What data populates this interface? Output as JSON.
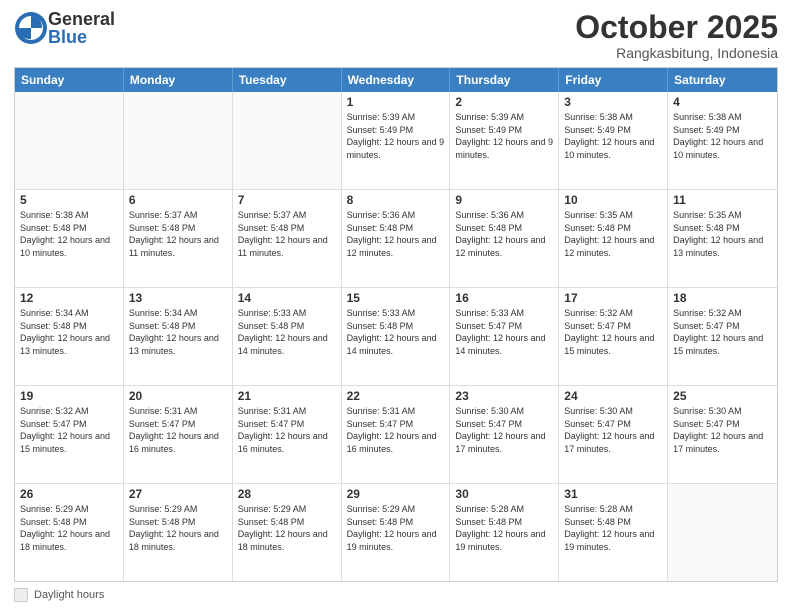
{
  "logo": {
    "general": "General",
    "blue": "Blue"
  },
  "title": "October 2025",
  "subtitle": "Rangkasbitung, Indonesia",
  "days_of_week": [
    "Sunday",
    "Monday",
    "Tuesday",
    "Wednesday",
    "Thursday",
    "Friday",
    "Saturday"
  ],
  "footer_label": "Daylight hours",
  "weeks": [
    [
      {
        "day": "",
        "info": ""
      },
      {
        "day": "",
        "info": ""
      },
      {
        "day": "",
        "info": ""
      },
      {
        "day": "1",
        "info": "Sunrise: 5:39 AM\nSunset: 5:49 PM\nDaylight: 12 hours\nand 9 minutes."
      },
      {
        "day": "2",
        "info": "Sunrise: 5:39 AM\nSunset: 5:49 PM\nDaylight: 12 hours\nand 9 minutes."
      },
      {
        "day": "3",
        "info": "Sunrise: 5:38 AM\nSunset: 5:49 PM\nDaylight: 12 hours\nand 10 minutes."
      },
      {
        "day": "4",
        "info": "Sunrise: 5:38 AM\nSunset: 5:49 PM\nDaylight: 12 hours\nand 10 minutes."
      }
    ],
    [
      {
        "day": "5",
        "info": "Sunrise: 5:38 AM\nSunset: 5:48 PM\nDaylight: 12 hours\nand 10 minutes."
      },
      {
        "day": "6",
        "info": "Sunrise: 5:37 AM\nSunset: 5:48 PM\nDaylight: 12 hours\nand 11 minutes."
      },
      {
        "day": "7",
        "info": "Sunrise: 5:37 AM\nSunset: 5:48 PM\nDaylight: 12 hours\nand 11 minutes."
      },
      {
        "day": "8",
        "info": "Sunrise: 5:36 AM\nSunset: 5:48 PM\nDaylight: 12 hours\nand 12 minutes."
      },
      {
        "day": "9",
        "info": "Sunrise: 5:36 AM\nSunset: 5:48 PM\nDaylight: 12 hours\nand 12 minutes."
      },
      {
        "day": "10",
        "info": "Sunrise: 5:35 AM\nSunset: 5:48 PM\nDaylight: 12 hours\nand 12 minutes."
      },
      {
        "day": "11",
        "info": "Sunrise: 5:35 AM\nSunset: 5:48 PM\nDaylight: 12 hours\nand 13 minutes."
      }
    ],
    [
      {
        "day": "12",
        "info": "Sunrise: 5:34 AM\nSunset: 5:48 PM\nDaylight: 12 hours\nand 13 minutes."
      },
      {
        "day": "13",
        "info": "Sunrise: 5:34 AM\nSunset: 5:48 PM\nDaylight: 12 hours\nand 13 minutes."
      },
      {
        "day": "14",
        "info": "Sunrise: 5:33 AM\nSunset: 5:48 PM\nDaylight: 12 hours\nand 14 minutes."
      },
      {
        "day": "15",
        "info": "Sunrise: 5:33 AM\nSunset: 5:48 PM\nDaylight: 12 hours\nand 14 minutes."
      },
      {
        "day": "16",
        "info": "Sunrise: 5:33 AM\nSunset: 5:47 PM\nDaylight: 12 hours\nand 14 minutes."
      },
      {
        "day": "17",
        "info": "Sunrise: 5:32 AM\nSunset: 5:47 PM\nDaylight: 12 hours\nand 15 minutes."
      },
      {
        "day": "18",
        "info": "Sunrise: 5:32 AM\nSunset: 5:47 PM\nDaylight: 12 hours\nand 15 minutes."
      }
    ],
    [
      {
        "day": "19",
        "info": "Sunrise: 5:32 AM\nSunset: 5:47 PM\nDaylight: 12 hours\nand 15 minutes."
      },
      {
        "day": "20",
        "info": "Sunrise: 5:31 AM\nSunset: 5:47 PM\nDaylight: 12 hours\nand 16 minutes."
      },
      {
        "day": "21",
        "info": "Sunrise: 5:31 AM\nSunset: 5:47 PM\nDaylight: 12 hours\nand 16 minutes."
      },
      {
        "day": "22",
        "info": "Sunrise: 5:31 AM\nSunset: 5:47 PM\nDaylight: 12 hours\nand 16 minutes."
      },
      {
        "day": "23",
        "info": "Sunrise: 5:30 AM\nSunset: 5:47 PM\nDaylight: 12 hours\nand 17 minutes."
      },
      {
        "day": "24",
        "info": "Sunrise: 5:30 AM\nSunset: 5:47 PM\nDaylight: 12 hours\nand 17 minutes."
      },
      {
        "day": "25",
        "info": "Sunrise: 5:30 AM\nSunset: 5:47 PM\nDaylight: 12 hours\nand 17 minutes."
      }
    ],
    [
      {
        "day": "26",
        "info": "Sunrise: 5:29 AM\nSunset: 5:48 PM\nDaylight: 12 hours\nand 18 minutes."
      },
      {
        "day": "27",
        "info": "Sunrise: 5:29 AM\nSunset: 5:48 PM\nDaylight: 12 hours\nand 18 minutes."
      },
      {
        "day": "28",
        "info": "Sunrise: 5:29 AM\nSunset: 5:48 PM\nDaylight: 12 hours\nand 18 minutes."
      },
      {
        "day": "29",
        "info": "Sunrise: 5:29 AM\nSunset: 5:48 PM\nDaylight: 12 hours\nand 19 minutes."
      },
      {
        "day": "30",
        "info": "Sunrise: 5:28 AM\nSunset: 5:48 PM\nDaylight: 12 hours\nand 19 minutes."
      },
      {
        "day": "31",
        "info": "Sunrise: 5:28 AM\nSunset: 5:48 PM\nDaylight: 12 hours\nand 19 minutes."
      },
      {
        "day": "",
        "info": ""
      }
    ]
  ]
}
